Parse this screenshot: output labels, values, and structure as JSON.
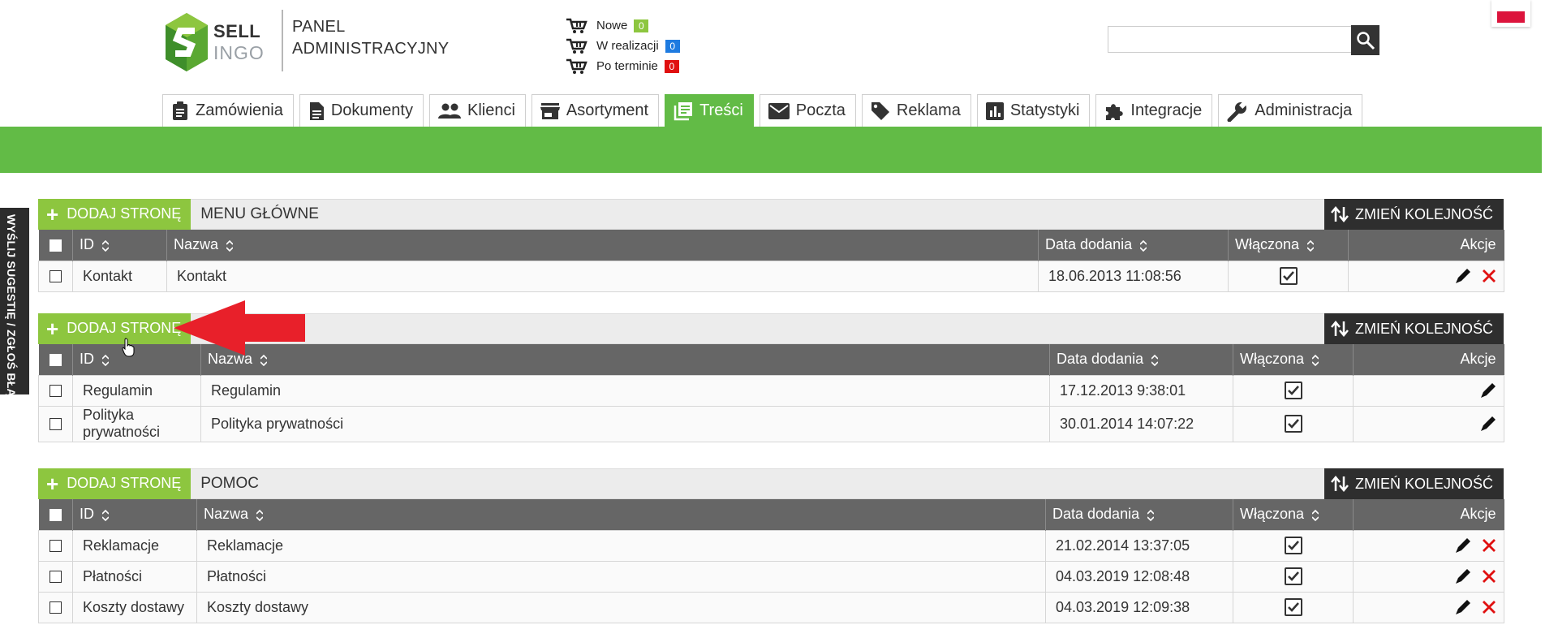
{
  "brand": {
    "logo_top": "SELL",
    "logo_bottom": "INGO",
    "panel_line1": "PANEL",
    "panel_line2": "ADMINISTRACYJNY"
  },
  "orders_status": [
    {
      "label": "Nowe",
      "count": "0",
      "color": "#8dc63f"
    },
    {
      "label": "W realizacji",
      "count": "0",
      "color": "#1e7be0"
    },
    {
      "label": "Po terminie",
      "count": "0",
      "color": "#e01010"
    }
  ],
  "search": {
    "placeholder": ""
  },
  "nav": [
    {
      "label": "Zamówienia",
      "icon": "clipboard-icon"
    },
    {
      "label": "Dokumenty",
      "icon": "document-icon"
    },
    {
      "label": "Klienci",
      "icon": "people-icon"
    },
    {
      "label": "Asortyment",
      "icon": "store-icon"
    },
    {
      "label": "Treści",
      "icon": "content-icon",
      "active": true
    },
    {
      "label": "Poczta",
      "icon": "mail-icon"
    },
    {
      "label": "Reklama",
      "icon": "tag-icon"
    },
    {
      "label": "Statystyki",
      "icon": "chart-icon"
    },
    {
      "label": "Integracje",
      "icon": "puzzle-icon"
    },
    {
      "label": "Administracja",
      "icon": "wrench-icon"
    }
  ],
  "side_feedback": "WYŚLIJ SUGESTIĘ / ZGŁOŚ BŁĄD",
  "common": {
    "add_page": "DODAJ STRONĘ",
    "change_order": "ZMIEŃ KOLEJNOŚĆ",
    "col_id": "ID",
    "col_name": "Nazwa",
    "col_date": "Data dodania",
    "col_enabled": "Włączona",
    "col_actions": "Akcje"
  },
  "sections": [
    {
      "title": "MENU GŁÓWNE",
      "rows": [
        {
          "id": "Kontakt",
          "name": "Kontakt",
          "date": "18.06.2013 11:08:56",
          "enabled": true,
          "can_delete": true
        }
      ]
    },
    {
      "title": "",
      "rows": [
        {
          "id": "Regulamin",
          "name": "Regulamin",
          "date": "17.12.2013 9:38:01",
          "enabled": true,
          "can_delete": false
        },
        {
          "id": "Polityka prywatności",
          "name": "Polityka prywatności",
          "date": "30.01.2014 14:07:22",
          "enabled": true,
          "can_delete": false
        }
      ]
    },
    {
      "title": "POMOC",
      "rows": [
        {
          "id": "Reklamacje",
          "name": "Reklamacje",
          "date": "21.02.2014 13:37:05",
          "enabled": true,
          "can_delete": true
        },
        {
          "id": "Płatności",
          "name": "Płatności",
          "date": "04.03.2019 12:08:48",
          "enabled": true,
          "can_delete": true
        },
        {
          "id": "Koszty dostawy",
          "name": "Koszty dostawy",
          "date": "04.03.2019 12:09:38",
          "enabled": true,
          "can_delete": true
        }
      ]
    }
  ]
}
